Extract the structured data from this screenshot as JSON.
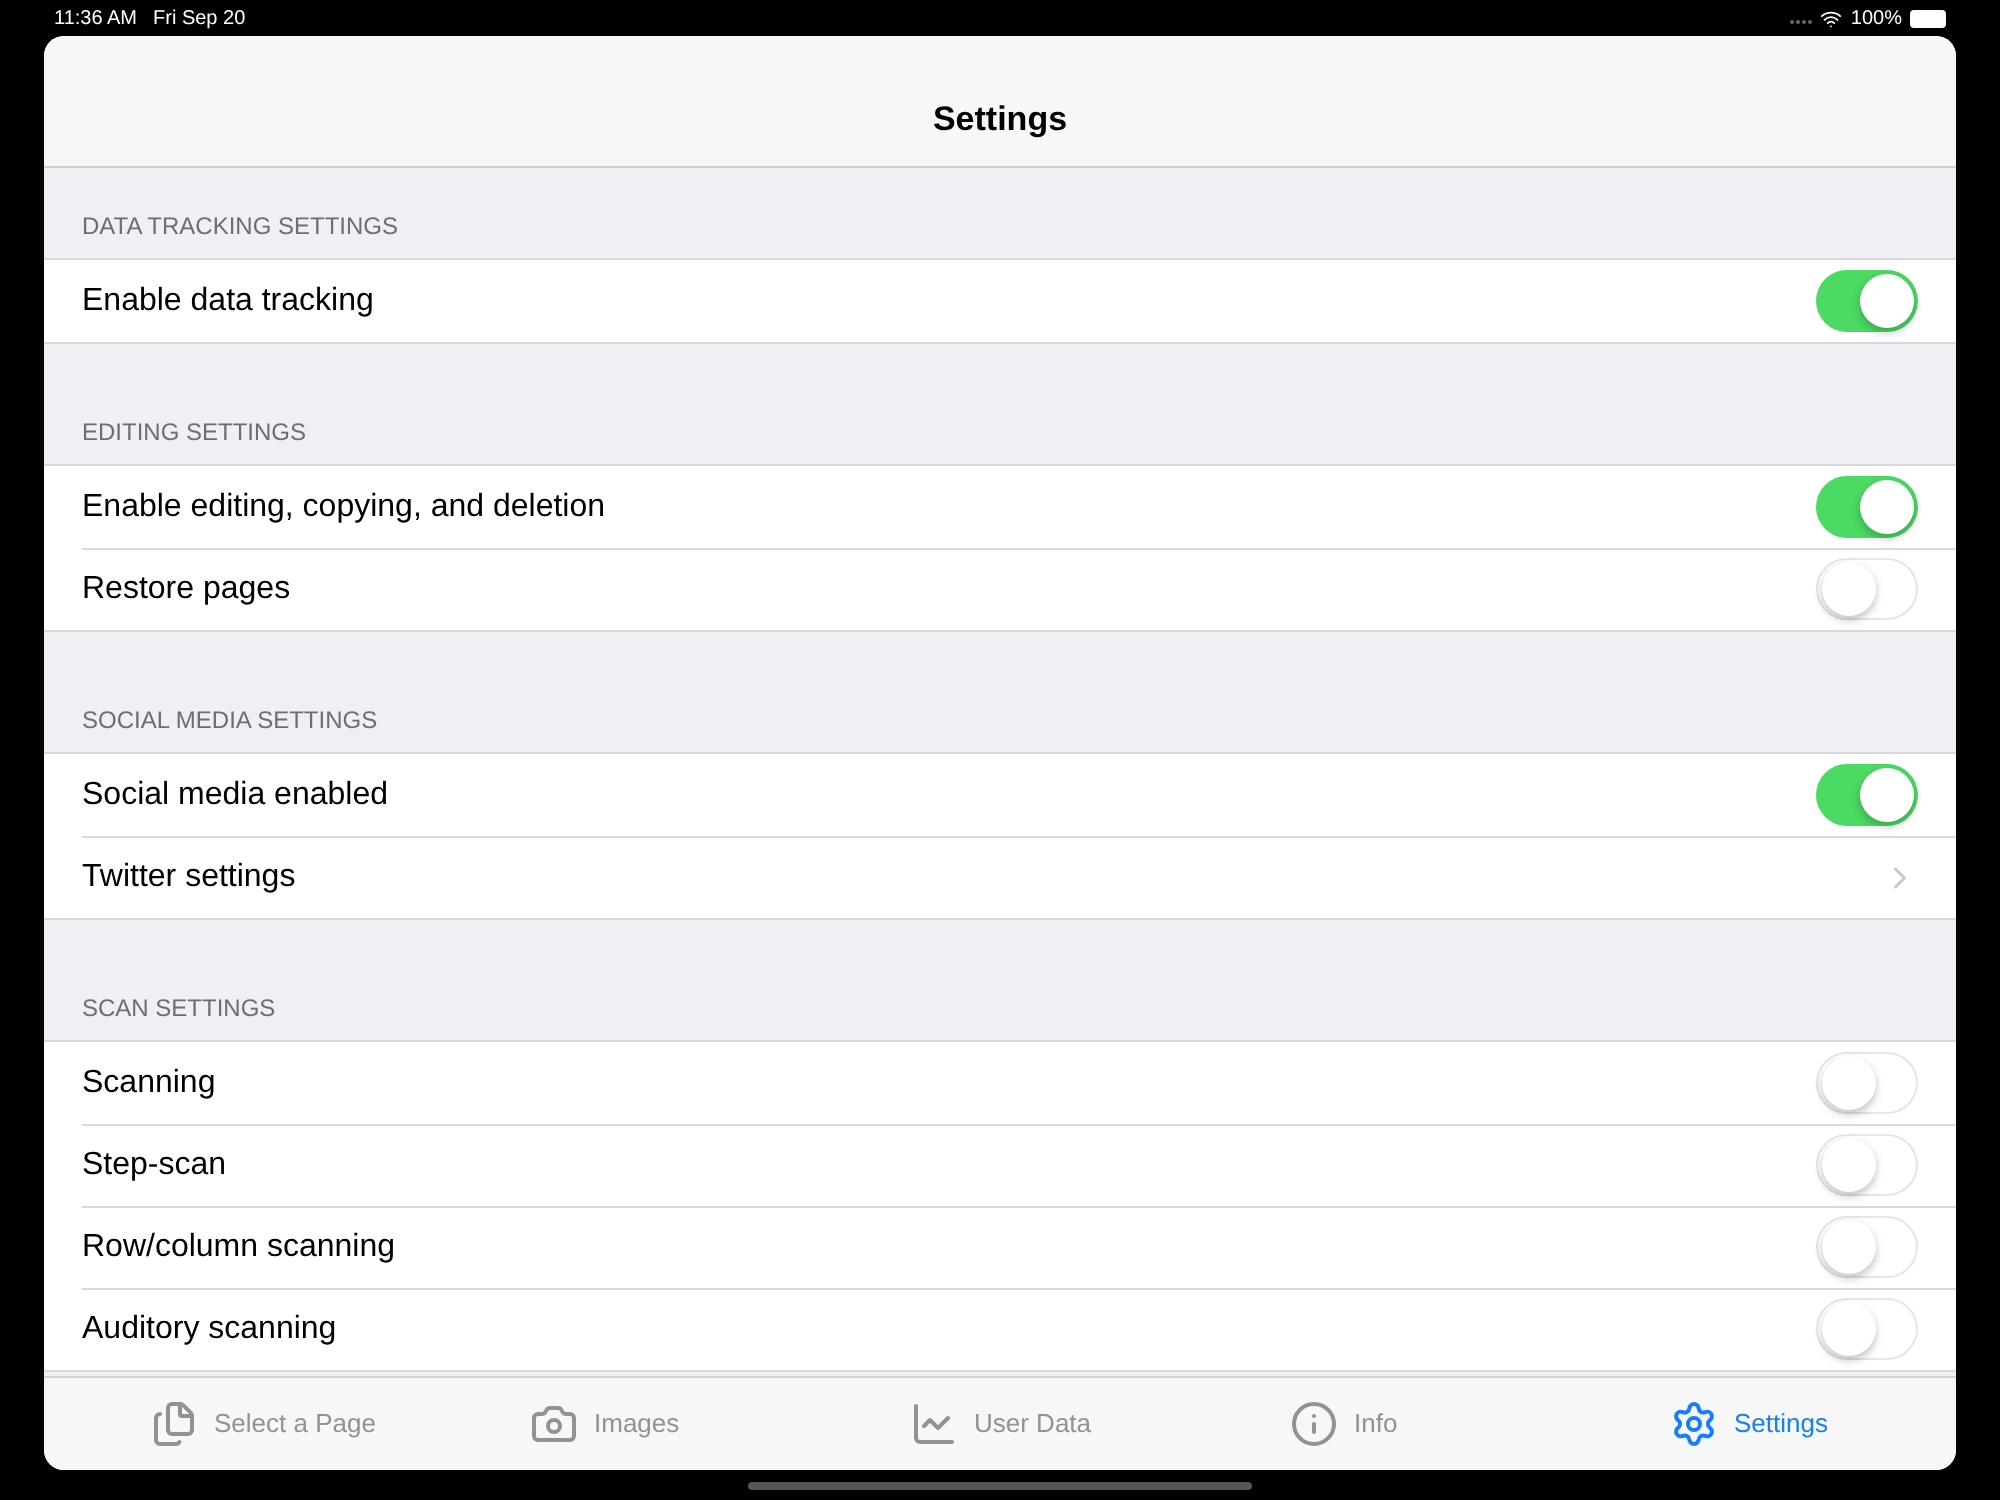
{
  "status_bar": {
    "time": "11:36 AM",
    "date": "Fri Sep 20",
    "battery": "100%"
  },
  "nav": {
    "title": "Settings"
  },
  "sections": [
    {
      "header": "DATA TRACKING SETTINGS",
      "rows": [
        {
          "kind": "toggle",
          "label": "Enable data tracking",
          "on": true
        }
      ]
    },
    {
      "header": "EDITING SETTINGS",
      "rows": [
        {
          "kind": "toggle",
          "label": "Enable editing, copying, and deletion",
          "on": true
        },
        {
          "kind": "toggle",
          "label": "Restore pages",
          "on": false
        }
      ]
    },
    {
      "header": "SOCIAL MEDIA SETTINGS",
      "rows": [
        {
          "kind": "toggle",
          "label": "Social media enabled",
          "on": true
        },
        {
          "kind": "link",
          "label": "Twitter settings"
        }
      ]
    },
    {
      "header": "SCAN SETTINGS",
      "rows": [
        {
          "kind": "toggle",
          "label": "Scanning",
          "on": false
        },
        {
          "kind": "toggle",
          "label": "Step-scan",
          "on": false
        },
        {
          "kind": "toggle",
          "label": "Row/column scanning",
          "on": false
        },
        {
          "kind": "toggle",
          "label": "Auditory scanning",
          "on": false
        }
      ]
    }
  ],
  "tabs": [
    {
      "label": "Select a Page",
      "selected": false
    },
    {
      "label": "Images",
      "selected": false
    },
    {
      "label": "User Data",
      "selected": false
    },
    {
      "label": "Info",
      "selected": false
    },
    {
      "label": "Settings",
      "selected": true
    }
  ]
}
